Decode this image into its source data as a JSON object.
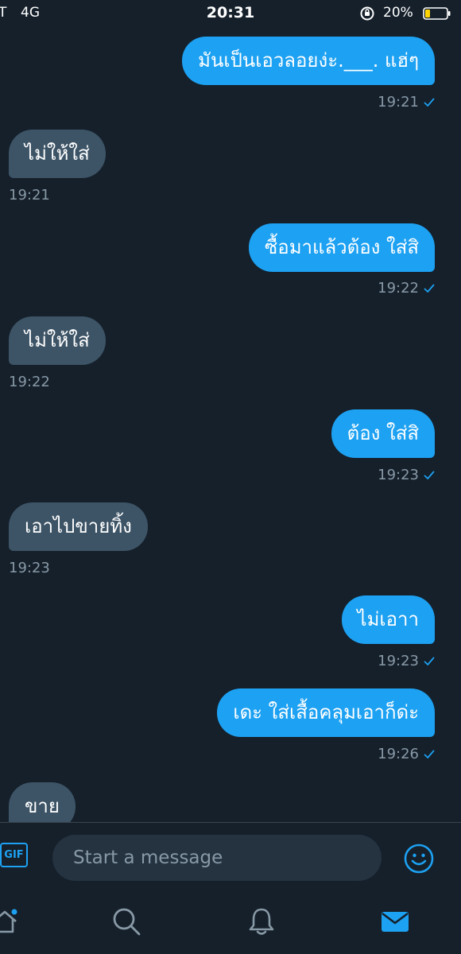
{
  "status_bar": {
    "carrier": "T",
    "network": "4G",
    "time": "20:31",
    "battery_percent": "20%"
  },
  "messages": [
    {
      "direction": "out",
      "text": "มันเป็นเอวลอยง่ะ.___. แฮ่ๆ",
      "time": "19:21",
      "read": true
    },
    {
      "direction": "in",
      "text": "ไม่ให้ใส่",
      "time": "19:21"
    },
    {
      "direction": "out",
      "text": "ซื้อมาแล้วต้อง ใส่สิ",
      "time": "19:22",
      "read": true
    },
    {
      "direction": "in",
      "text": "ไม่ให้ใส่",
      "time": "19:22"
    },
    {
      "direction": "out",
      "text": "ต้อง ใส่สิ",
      "time": "19:23",
      "read": true
    },
    {
      "direction": "in",
      "text": "เอาไปขายทิ้ง",
      "time": "19:23"
    },
    {
      "direction": "out",
      "text": "ไม่เอาา",
      "time": "19:23",
      "read": true
    },
    {
      "direction": "out",
      "text": "เดะ ใส่เสื้อคลุมเอาก็ด่ะ",
      "time": "19:26",
      "read": true
    },
    {
      "direction": "in",
      "text": "ขาย",
      "time": ""
    }
  ],
  "composer": {
    "gif_label": "GIF",
    "placeholder": "Start a message"
  },
  "tabs": [
    "home-icon",
    "search-icon",
    "bell-icon",
    "mail-icon"
  ],
  "colors": {
    "background": "#15202b",
    "outgoing_bubble": "#1da1f2",
    "incoming_bubble": "#3d5466",
    "secondary_text": "#8899a6",
    "accent": "#1da1f2",
    "battery_low": "#ffd400"
  }
}
